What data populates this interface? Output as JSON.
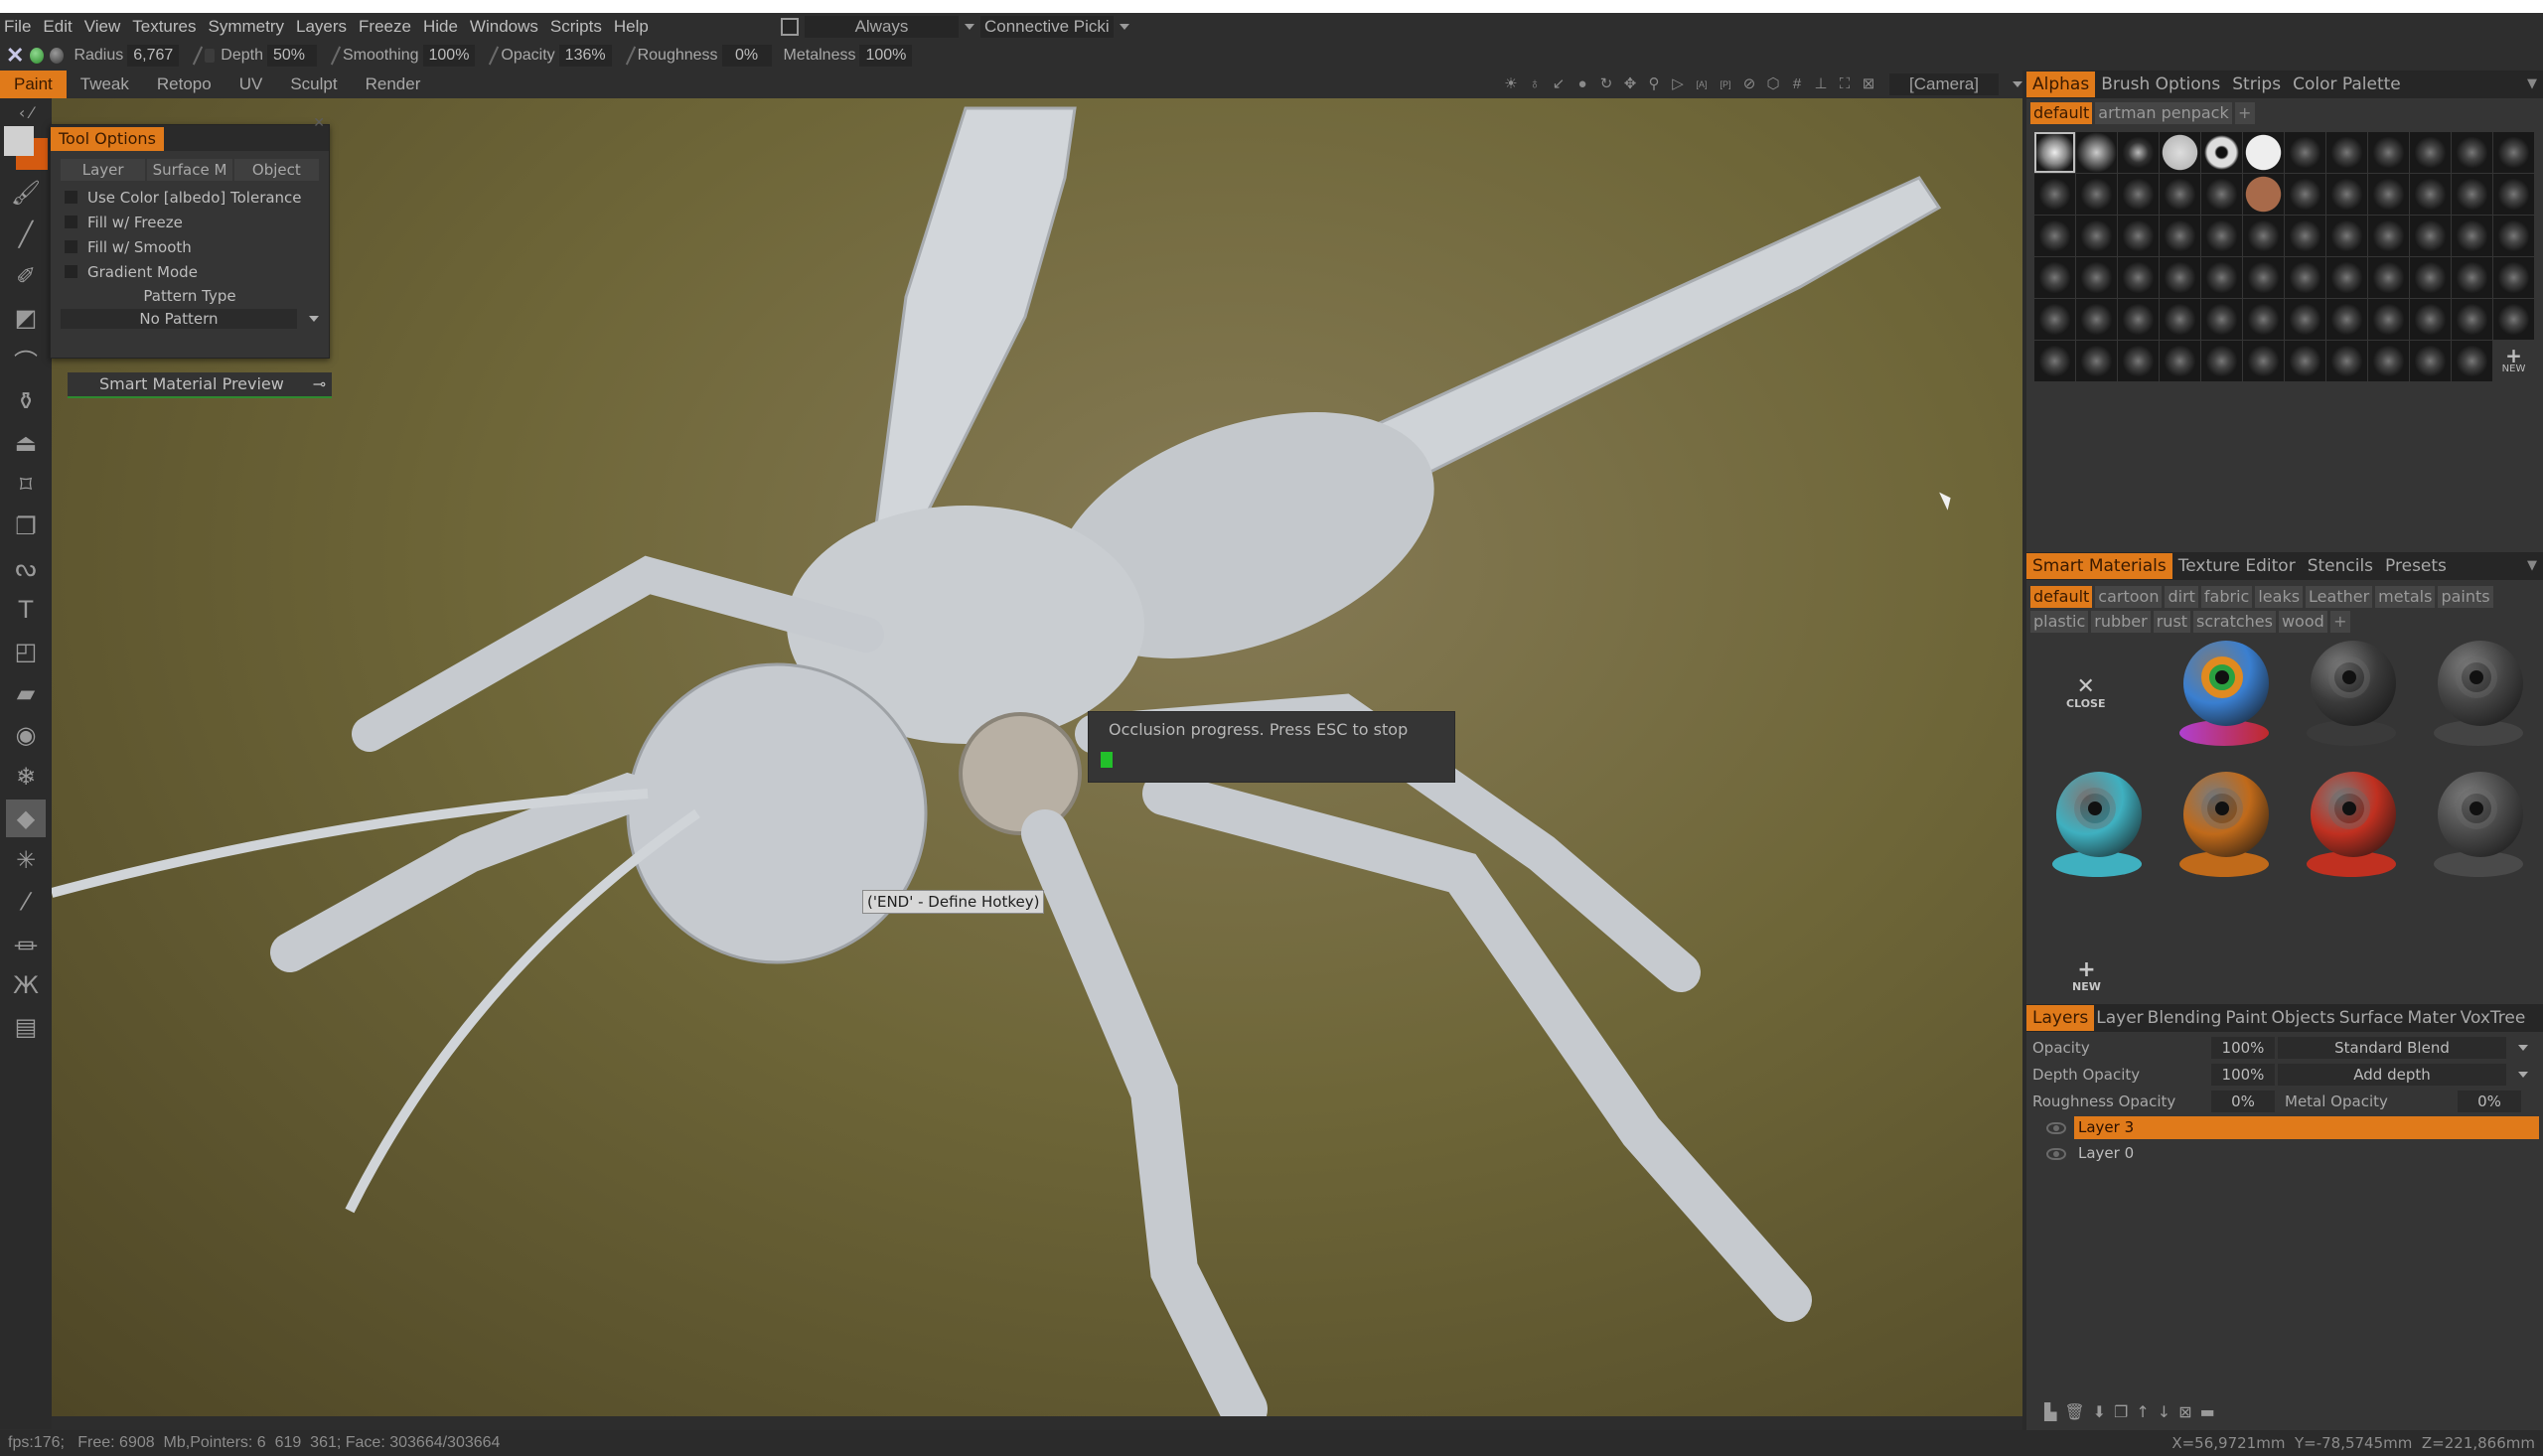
{
  "menu": {
    "items": [
      "File",
      "Edit",
      "View",
      "Textures",
      "Symmetry",
      "Layers",
      "Freeze",
      "Hide",
      "Windows",
      "Scripts",
      "Help"
    ],
    "always_label": "Always",
    "connective_label": "Connective Picki"
  },
  "brush": {
    "radius_label": "Radius",
    "radius_value": "6,767",
    "depth_label": "Depth",
    "depth_value": "50%",
    "smoothing_label": "Smoothing",
    "smoothing_value": "100%",
    "opacity_label": "Opacity",
    "opacity_value": "136%",
    "roughness_label": "Roughness",
    "roughness_value": "0%",
    "metalness_label": "Metalness",
    "metalness_value": "100%"
  },
  "rooms": {
    "items": [
      "Paint",
      "Tweak",
      "Retopo",
      "UV",
      "Sculpt",
      "Render"
    ],
    "active": "Paint"
  },
  "viewport_toolbar": {
    "icons": [
      "sun-icon",
      "bulb-icon",
      "bulb-arrow-icon",
      "drop-icon",
      "rotate-icon",
      "move-icon",
      "zoom-icon",
      "play-icon",
      "frame-all-icon",
      "frame-pen-icon",
      "no-icon",
      "cube-icon",
      "grid-icon",
      "axis-icon",
      "fullscreen-icon",
      "image-icon"
    ],
    "camera": "[Camera]"
  },
  "left_tools": [
    "brush-icon",
    "pencil-icon",
    "airbrush-icon",
    "clone-brush-icon",
    "smudge-icon",
    "fill-bucket-icon",
    "stamp-icon",
    "transform-icon",
    "copy-paste-icon",
    "curve-icon",
    "text-icon",
    "frame-icon",
    "eraser-icon",
    "eye-icon",
    "freeze-icon",
    "fill-icon",
    "magic-wand-icon",
    "eyedropper-icon",
    "iron-icon",
    "butterfly-icon",
    "ruler-icon"
  ],
  "tool_options": {
    "title": "Tool Options",
    "buttons": [
      "Layer",
      "Surface M",
      "Object"
    ],
    "checkboxes": [
      "Use Color [albedo] Tolerance",
      "Fill w/ Freeze",
      "Fill w/ Smooth",
      "Gradient Mode"
    ],
    "pattern_label": "Pattern Type",
    "pattern_value": "No Pattern"
  },
  "smart_material_preview": "Smart Material Preview",
  "occlusion": {
    "message": "Occlusion progress. Press ESC to stop",
    "progress": 0.02,
    "color": "#22c02a"
  },
  "hotkey_tip": "('END' - Define Hotkey)",
  "alphas_panel": {
    "tabs": [
      "Alphas",
      "Brush Options",
      "Strips",
      "Color Palette"
    ],
    "active_tab": "Alphas",
    "folders": [
      "default",
      "artman penpack"
    ],
    "active_folder": "default",
    "new_label": "NEW",
    "count": 71
  },
  "materials_panel": {
    "tabs": [
      "Smart Materials",
      "Texture Editor",
      "Stencils",
      "Presets"
    ],
    "active_tab": "Smart Materials",
    "folders": [
      "default",
      "cartoon",
      "dirt",
      "fabric",
      "leaks",
      "Leather",
      "metals",
      "paints",
      "plastic",
      "rubber",
      "rust",
      "scratches",
      "wood"
    ],
    "active_folder": "default",
    "close_label": "CLOSE",
    "new_label": "NEW",
    "materials": [
      {
        "name": "cartoon-ball",
        "color": "#3a7fd0"
      },
      {
        "name": "dark-metal",
        "color": "#3a3a3a"
      },
      {
        "name": "dark-gray",
        "color": "#444444"
      },
      {
        "name": "teal-carbon",
        "color": "#3fb0c0"
      },
      {
        "name": "orange-leather",
        "color": "#c06a1a"
      },
      {
        "name": "red-paint",
        "color": "#c03020"
      },
      {
        "name": "gray-stone",
        "color": "#4a4a4a"
      }
    ]
  },
  "layers_panel": {
    "tabs": [
      "Layers",
      "Layer",
      "Blending",
      "Paint",
      "Objects",
      "Surface",
      "Mater",
      "VoxTree"
    ],
    "active_tab": "Layers",
    "opacity_label": "Opacity",
    "opacity_value": "100%",
    "blend_mode": "Standard Blend",
    "depth_opacity_label": "Depth Opacity",
    "depth_opacity_value": "100%",
    "depth_mode": "Add depth",
    "roughness_opacity_label": "Roughness Opacity",
    "roughness_opacity_value": "0%",
    "metal_opacity_label": "Metal Opacity",
    "metal_opacity_value": "0%",
    "layers": [
      "Layer 3",
      "Layer 0"
    ],
    "active_layer": "Layer 3"
  },
  "status": {
    "left": "fps:176;   Free: 6908  Mb,Pointers: 6  619  361; Face: 303664/303664",
    "coords": "X=56,9721mm  Y=-78,5745mm  Z=221,866mm"
  },
  "accent_color": "#e07a1a"
}
